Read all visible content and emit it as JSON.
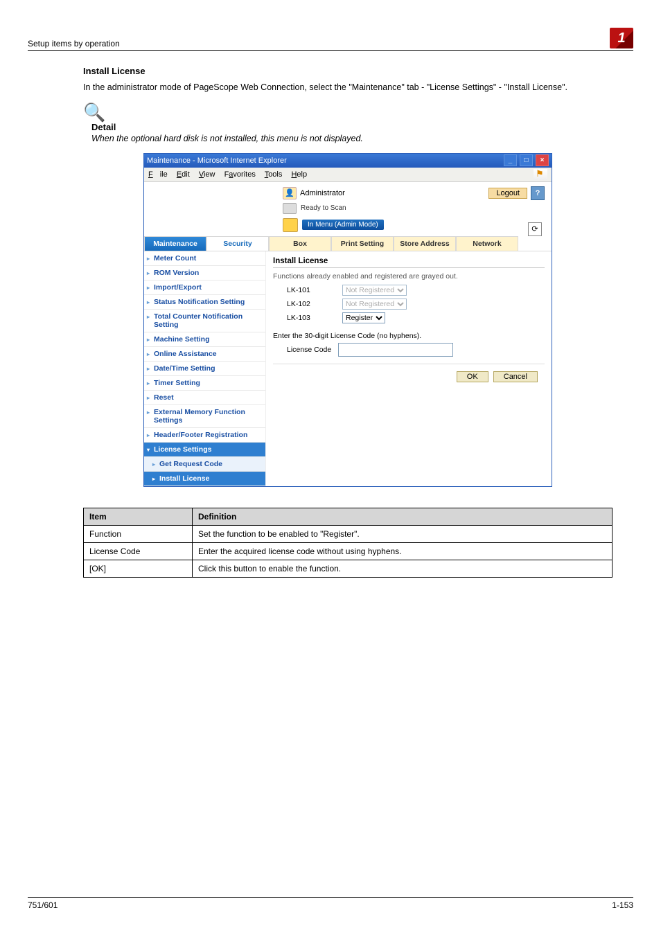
{
  "header": {
    "breadcrumb": "Setup items by operation",
    "chapter": "1"
  },
  "section": {
    "title": "Install License",
    "intro": "In the administrator mode of PageScope Web Connection, select the \"Maintenance\" tab - \"License Settings\" - \"Install License\"."
  },
  "detail": {
    "label": "Detail",
    "text": "When the optional hard disk is not installed, this menu is not displayed."
  },
  "ie": {
    "title": "Maintenance - Microsoft Internet Explorer",
    "menu": {
      "file": "File",
      "edit": "Edit",
      "view": "View",
      "favorites": "Favorites",
      "tools": "Tools",
      "help": "Help"
    }
  },
  "app": {
    "admin": "Administrator",
    "logout": "Logout",
    "help": "?",
    "status_text": "Ready to Scan",
    "status_pill": "In Menu (Admin Mode)"
  },
  "tabs": [
    "Maintenance",
    "Security",
    "Box",
    "Print Setting",
    "Store Address",
    "Network"
  ],
  "sidebar": [
    {
      "label": "Meter Count"
    },
    {
      "label": "ROM Version"
    },
    {
      "label": "Import/Export"
    },
    {
      "label": "Status Notification Setting"
    },
    {
      "label": "Total Counter Notification Setting"
    },
    {
      "label": "Machine Setting"
    },
    {
      "label": "Online Assistance"
    },
    {
      "label": "Date/Time Setting"
    },
    {
      "label": "Timer Setting"
    },
    {
      "label": "Reset"
    },
    {
      "label": "External Memory Function Settings"
    },
    {
      "label": "Header/Footer Registration"
    },
    {
      "label": "License Settings",
      "expanded": true
    },
    {
      "label": "Get Request Code",
      "sub": true
    },
    {
      "label": "Install License",
      "sub": true,
      "active": true
    }
  ],
  "panel": {
    "heading": "Install License",
    "grayed_note": "Functions already enabled and registered are grayed out.",
    "rows": [
      {
        "name": "LK-101",
        "value": "Not Registered",
        "gray": true
      },
      {
        "name": "LK-102",
        "value": "Not Registered",
        "gray": true
      },
      {
        "name": "LK-103",
        "value": "Register",
        "gray": false
      }
    ],
    "enter_text": "Enter the 30-digit License Code (no hyphens).",
    "code_label": "License Code",
    "ok": "OK",
    "cancel": "Cancel"
  },
  "table": {
    "headers": [
      "Item",
      "Definition"
    ],
    "rows": [
      [
        "Function",
        "Set the function to be enabled to \"Register\"."
      ],
      [
        "License Code",
        "Enter the acquired license code without using hyphens."
      ],
      [
        "[OK]",
        "Click this button to enable the function."
      ]
    ]
  },
  "footer": {
    "left": "751/601",
    "right": "1-153"
  }
}
